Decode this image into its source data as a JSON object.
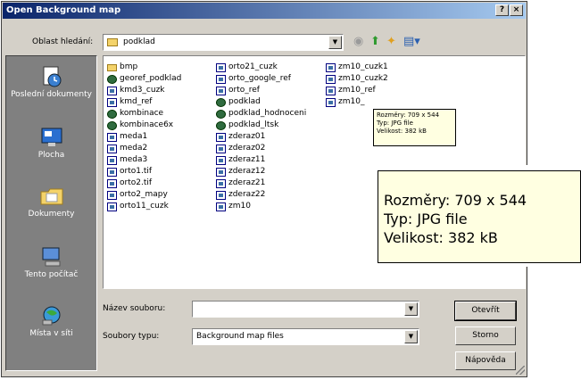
{
  "window": {
    "title": "Open Background map",
    "help_btn": "?",
    "close_btn": "×"
  },
  "lookin": {
    "label": "Oblast hledání:",
    "value": "podklad"
  },
  "places": [
    {
      "label": "Poslední dokumenty",
      "icon": "recent-documents-icon"
    },
    {
      "label": "Plocha",
      "icon": "desktop-icon"
    },
    {
      "label": "Dokumenty",
      "icon": "documents-folder-icon"
    },
    {
      "label": "Tento počítač",
      "icon": "computer-icon"
    },
    {
      "label": "Místa v síti",
      "icon": "network-icon"
    }
  ],
  "files": {
    "col1": [
      "bmp",
      "georef_podklad",
      "kmd3_cuzk",
      "kmd_ref",
      "kombinace",
      "kombinace6x",
      "meda1",
      "meda2",
      "meda3",
      "orto1.tif",
      "orto2.tif",
      "orto2_mapy",
      "orto11_cuzk"
    ],
    "col2": [
      "orto21_cuzk",
      "orto_google_ref",
      "orto_ref",
      "podklad",
      "podklad_hodnoceni",
      "podklad_ltsk",
      "zderaz01",
      "zderaz02",
      "zderaz11",
      "zderaz12",
      "zderaz21",
      "zderaz22",
      "zm10"
    ],
    "col3": [
      "zm10_cuzk1",
      "zm10_cuzk2",
      "zm10_ref",
      "zm10_"
    ]
  },
  "filename": {
    "label": "Název souboru:",
    "value": ""
  },
  "filetype": {
    "label": "Soubory typu:",
    "value": "Background map files"
  },
  "buttons": {
    "open": "Otevřít",
    "cancel": "Storno",
    "help": "Nápověda"
  },
  "tooltip_small": {
    "line1": "Rozměry: 709 x 544",
    "line2": "Typ: JPG file",
    "line3": "Velikost: 382 kB"
  },
  "tooltip_big": {
    "line1": "Rozměry: 709 x 544",
    "line2": "Typ: JPG file",
    "line3": "Velikost: 382 kB"
  }
}
